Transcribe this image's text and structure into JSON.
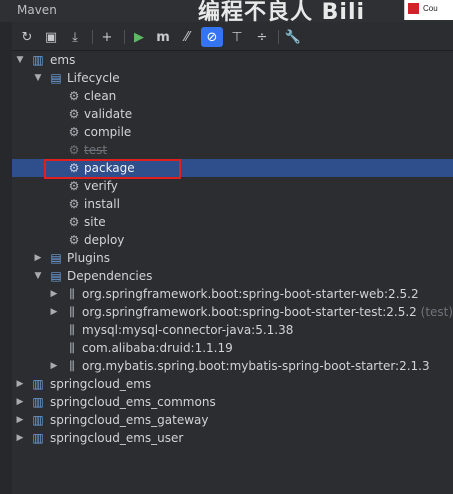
{
  "window": {
    "title": "Maven",
    "overlay_text": "编程不良人 Bili",
    "corner_tab": "Cou"
  },
  "toolbar": [
    {
      "name": "reload-icon",
      "glyph": "↻"
    },
    {
      "name": "add-maven-project-icon",
      "glyph": "▣"
    },
    {
      "name": "download-sources-icon",
      "glyph": "⤓"
    },
    {
      "name": "add-icon",
      "glyph": "+"
    },
    {
      "name": "run-icon",
      "glyph": "▶"
    },
    {
      "name": "execute-goal-icon",
      "glyph": "m"
    },
    {
      "name": "toggle-offline-icon",
      "glyph": "⁄⁄"
    },
    {
      "name": "skip-tests-icon",
      "glyph": "⊘"
    },
    {
      "name": "show-dependencies-icon",
      "glyph": "⊤"
    },
    {
      "name": "collapse-all-icon",
      "glyph": "÷"
    },
    {
      "name": "settings-icon",
      "glyph": "🔧"
    }
  ],
  "tree": {
    "ems": "ems",
    "lifecycle": "Lifecycle",
    "goals": [
      "clean",
      "validate",
      "compile",
      "test",
      "package",
      "verify",
      "install",
      "site",
      "deploy"
    ],
    "plugins": "Plugins",
    "dependencies_label": "Dependencies",
    "dependencies": [
      {
        "name": "org.springframework.boot:spring-boot-starter-web:2.5.2",
        "suffix": ""
      },
      {
        "name": "org.springframework.boot:spring-boot-starter-test:2.5.2",
        "suffix": "(test)"
      },
      {
        "name": "mysql:mysql-connector-java:5.1.38",
        "suffix": ""
      },
      {
        "name": "com.alibaba:druid:1.1.19",
        "suffix": ""
      },
      {
        "name": "org.mybatis.spring.boot:mybatis-spring-boot-starter:2.1.3",
        "suffix": ""
      }
    ],
    "projects": [
      "springcloud_ems",
      "springcloud_ems_commons",
      "springcloud_ems_gateway",
      "springcloud_ems_user"
    ]
  }
}
